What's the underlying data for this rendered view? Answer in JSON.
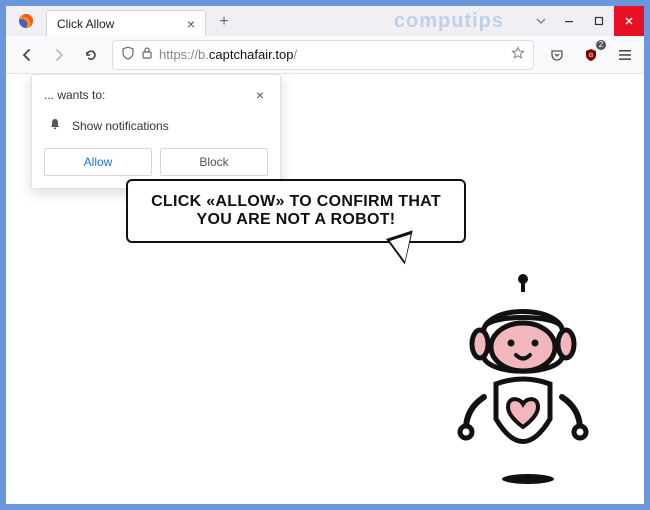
{
  "watermark": "computips",
  "tab": {
    "title": "Click Allow"
  },
  "url": {
    "protocol": "https://",
    "host": "b.",
    "domain": "captchafair.top",
    "path": "/"
  },
  "ublock_count": "2",
  "permission": {
    "prompt": "... wants to:",
    "capability": "Show notifications",
    "allow": "Allow",
    "block": "Block"
  },
  "page": {
    "headline": "CLICK «ALLOW» TO CONFIRM THAT YOU ARE NOT A ROBOT!"
  }
}
